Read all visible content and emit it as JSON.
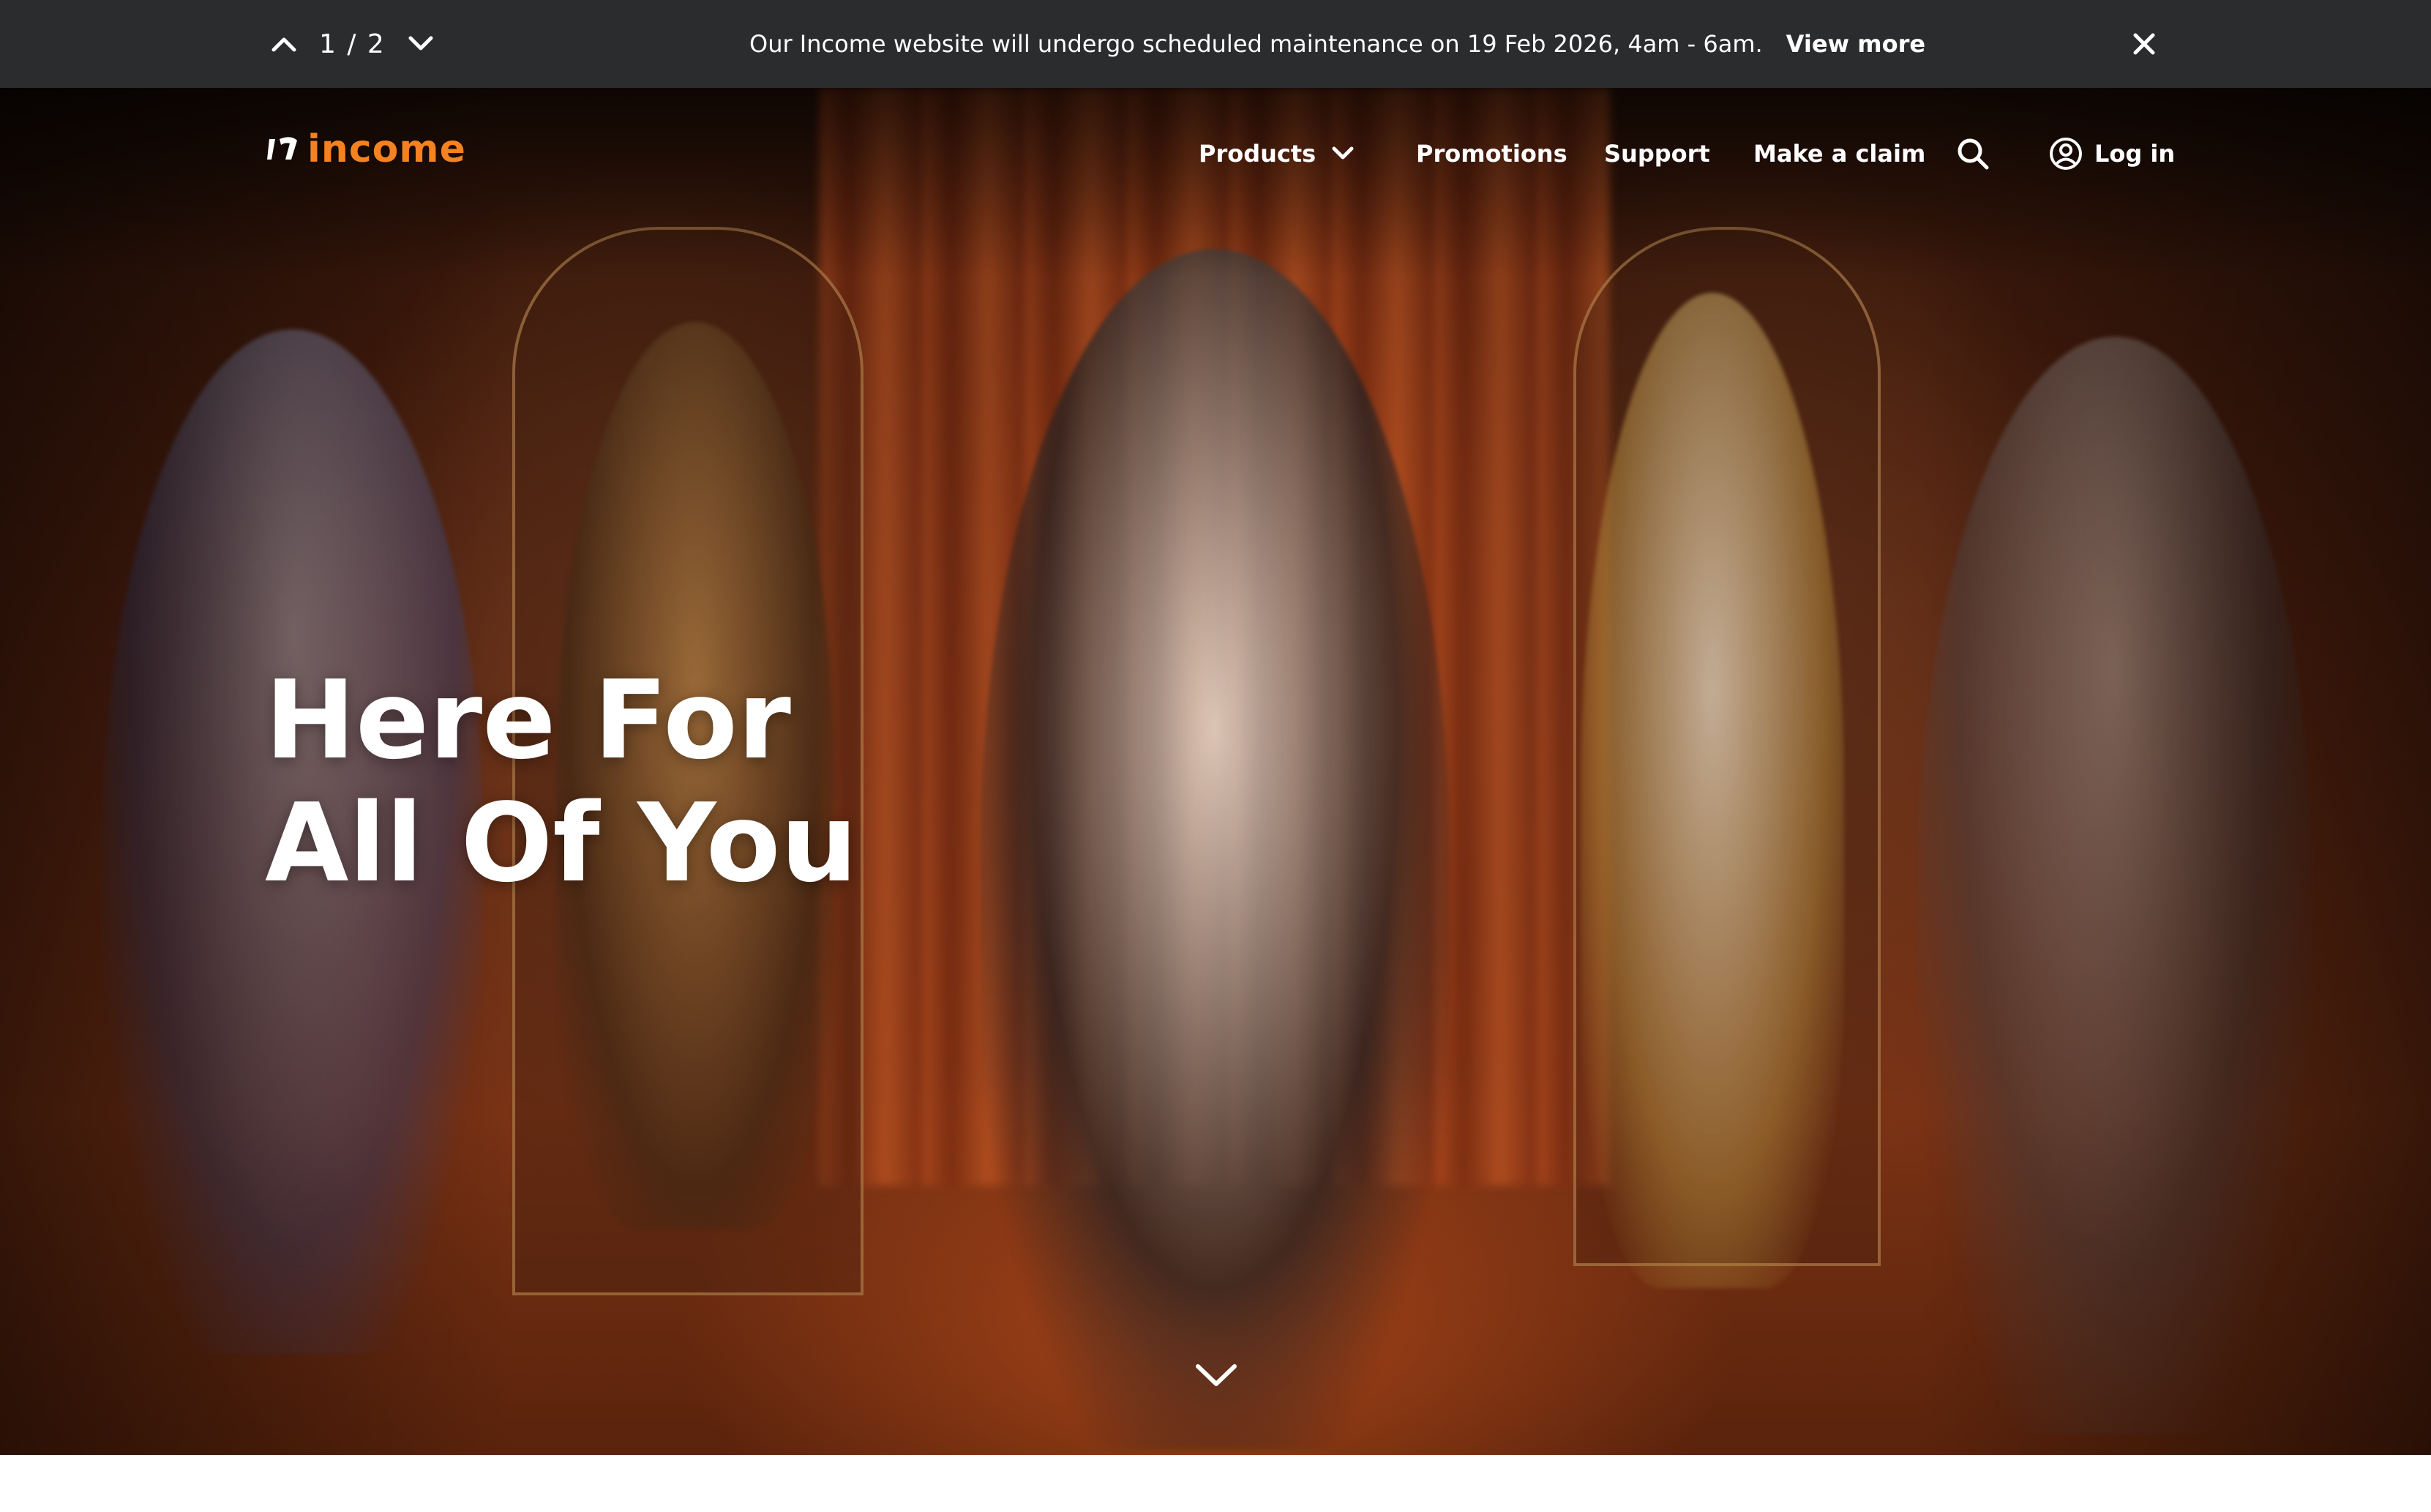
{
  "announcement": {
    "pager": "1 / 2",
    "message": "Our Income website will undergo scheduled maintenance on 19 Feb 2026, 4am - 6am.",
    "link_label": "View more",
    "icons": {
      "prev": "chevron-up-icon",
      "next": "chevron-down-icon",
      "close": "close-icon"
    }
  },
  "nav": {
    "logo_text": "income",
    "items": [
      {
        "label": "Products",
        "has_dropdown": true
      },
      {
        "label": "Promotions"
      },
      {
        "label": "Support"
      },
      {
        "label": "Make a claim"
      }
    ],
    "search_icon": "search-icon",
    "login_label": "Log in",
    "login_icon": "user-circle-icon"
  },
  "hero": {
    "headline_line1": "Here For",
    "headline_line2": "All Of You",
    "scroll_icon": "chevron-down-icon"
  },
  "colors": {
    "brand": "#f58220",
    "announcement_bg": "#2b2c2d",
    "text": "#ffffff"
  }
}
